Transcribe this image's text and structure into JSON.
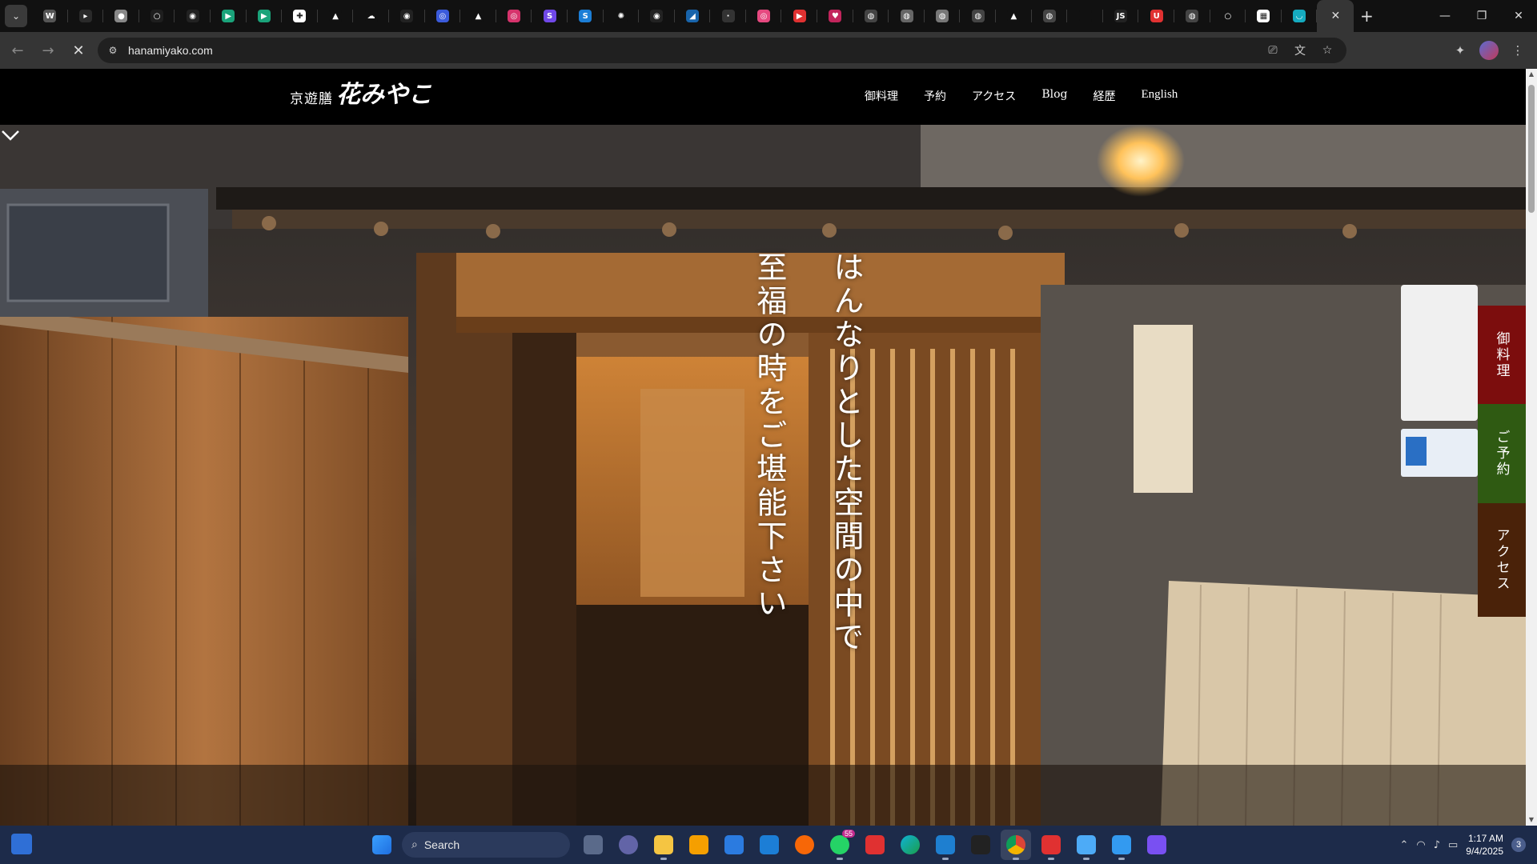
{
  "browser": {
    "tab_favicons": [
      {
        "name": "wikipedia",
        "color": "#555555",
        "glyph": "W"
      },
      {
        "name": "video",
        "color": "#2a2a2a",
        "glyph": "▸"
      },
      {
        "name": "circle",
        "color": "#888888",
        "glyph": "●"
      },
      {
        "name": "dark",
        "color": "#1e1e1e",
        "glyph": "○"
      },
      {
        "name": "github",
        "color": "#222222",
        "glyph": "◉"
      },
      {
        "name": "green-app",
        "color": "#1aa37a",
        "glyph": "▶"
      },
      {
        "name": "green-app-2",
        "color": "#1aa37a",
        "glyph": "▶"
      },
      {
        "name": "plus-app",
        "color": "#ffffff",
        "glyph": "✚"
      },
      {
        "name": "triangle",
        "color": "#111111",
        "glyph": "▲"
      },
      {
        "name": "cloud",
        "color": "#111111",
        "glyph": "☁"
      },
      {
        "name": "github-2",
        "color": "#222222",
        "glyph": "◉"
      },
      {
        "name": "blue-ring",
        "color": "#3b5bdb",
        "glyph": "◎"
      },
      {
        "name": "triangle-2",
        "color": "#111111",
        "glyph": "▲"
      },
      {
        "name": "pink-ring",
        "color": "#d6336c",
        "glyph": "◎"
      },
      {
        "name": "purple-s",
        "color": "#7048e8",
        "glyph": "S"
      },
      {
        "name": "slash",
        "color": "#1c7ed6",
        "glyph": "S"
      },
      {
        "name": "openai",
        "color": "#111111",
        "glyph": "✺"
      },
      {
        "name": "github-3",
        "color": "#222222",
        "glyph": "◉"
      },
      {
        "name": "chart",
        "color": "#1864ab",
        "glyph": "◢"
      },
      {
        "name": "dim",
        "color": "#333333",
        "glyph": "·"
      },
      {
        "name": "instagram",
        "color": "#e64980",
        "glyph": "◎"
      },
      {
        "name": "youtube",
        "color": "#e03131",
        "glyph": "▶"
      },
      {
        "name": "lips",
        "color": "#c2255c",
        "glyph": "♥"
      },
      {
        "name": "globe",
        "color": "#444444",
        "glyph": "◍"
      },
      {
        "name": "globe-2",
        "color": "#666666",
        "glyph": "◍"
      },
      {
        "name": "globe-3",
        "color": "#777777",
        "glyph": "◍"
      },
      {
        "name": "globe-4",
        "color": "#444444",
        "glyph": "◍"
      },
      {
        "name": "triangle-3",
        "color": "#111111",
        "glyph": "▲"
      },
      {
        "name": "globe-5",
        "color": "#444444",
        "glyph": "◍"
      },
      {
        "name": "blank",
        "color": "#111111",
        "glyph": ""
      },
      {
        "name": "js",
        "color": "#222222",
        "glyph": "JS"
      },
      {
        "name": "magnet",
        "color": "#e03131",
        "glyph": "U"
      },
      {
        "name": "search-globe",
        "color": "#444444",
        "glyph": "◍"
      },
      {
        "name": "ring",
        "color": "#111111",
        "glyph": "○"
      },
      {
        "name": "grid",
        "color": "#ffffff",
        "glyph": "▦"
      },
      {
        "name": "bird",
        "color": "#15aabf",
        "glyph": "◡"
      }
    ],
    "active_tab_close": "✕",
    "new_tab": "+",
    "window_controls": {
      "minimize": "—",
      "restore": "❐",
      "close": "✕"
    },
    "back": "←",
    "forward": "→",
    "stop": "✕",
    "url": "hanamiyako.com"
  },
  "site": {
    "logo_small": "京遊膳",
    "logo_big": "花みやこ",
    "nav": [
      {
        "label": "御料理"
      },
      {
        "label": "予約"
      },
      {
        "label": "アクセス"
      },
      {
        "label": "Blog"
      },
      {
        "label": "経歴"
      },
      {
        "label": "English"
      }
    ],
    "hero_copy_1": "はんなりとした空間の中で",
    "hero_copy_2": "至福の時をご堪能下さい",
    "side_tabs": [
      {
        "label": "御料理",
        "color": "#7c0d0d"
      },
      {
        "label": "ご予約",
        "color": "#2f5a12"
      },
      {
        "label": "アクセス",
        "color": "#4a2209"
      }
    ]
  },
  "taskbar": {
    "search_label": "Search",
    "whatsapp_badge": "55",
    "time": "1:17 AM",
    "date": "9/4/2025",
    "notification_count": "3"
  }
}
